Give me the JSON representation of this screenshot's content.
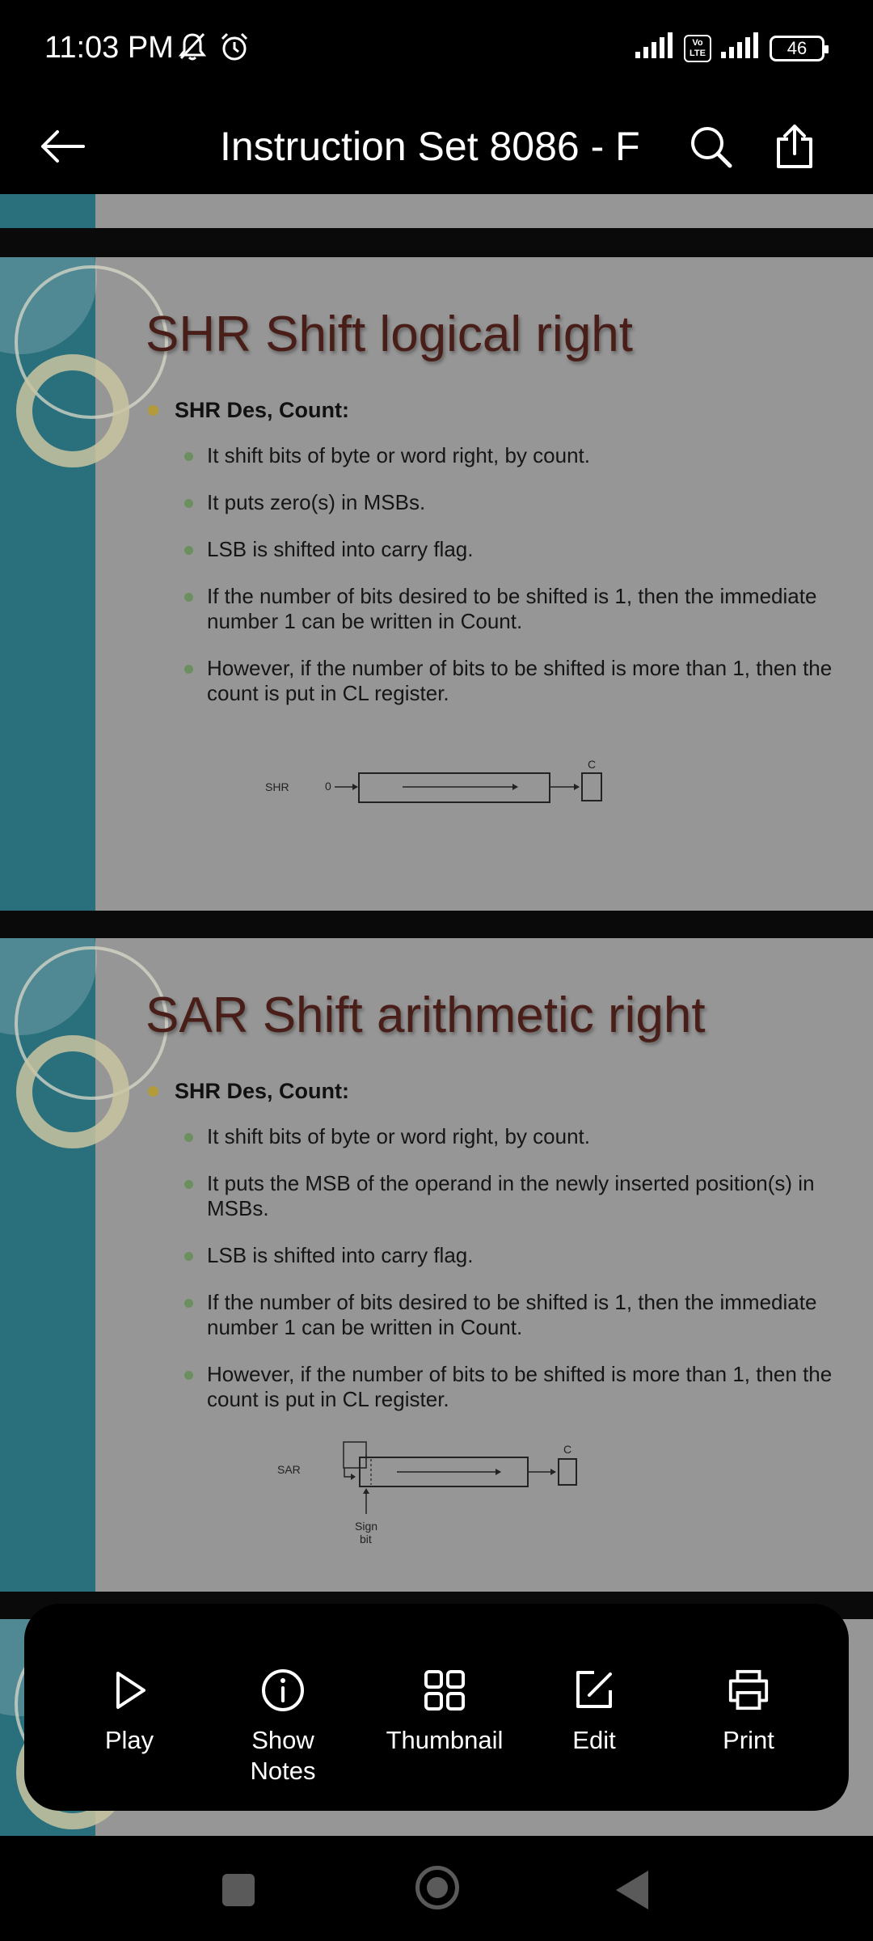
{
  "status_bar": {
    "time": "11:03 PM",
    "battery": "46",
    "volte_label": "Vo LTE",
    "icons": [
      "mute-bell-icon",
      "alarm-icon",
      "signal-icon",
      "volte-icon",
      "signal-icon",
      "battery-icon"
    ]
  },
  "app_bar": {
    "title": "Instruction Set 8086 - F",
    "icons": [
      "back-arrow-icon",
      "search-icon",
      "share-icon"
    ]
  },
  "slides": [
    {
      "title": "SHR Shift logical right",
      "main_bullet": "SHR Des, Count:",
      "sub_bullets": [
        "It shift bits of byte or word right, by count.",
        "It puts zero(s) in MSBs.",
        "LSB is shifted into carry flag.",
        "If the number of bits desired to be shifted is 1, then the  immediate number 1 can be written in Count.",
        "However, if the number of bits to be shifted is more than  1, then the count is put in CL register."
      ],
      "diagram": {
        "label": "SHR",
        "input": "0",
        "carry": "C"
      }
    },
    {
      "title": "SAR Shift arithmetic right",
      "main_bullet": "SHR Des, Count:",
      "sub_bullets": [
        "It shift bits of byte or word right, by count.",
        "It puts the MSB of the operand in the newly inserted position(s) in MSBs.",
        "LSB is shifted into carry flag.",
        "If the number of bits desired to be shifted is 1, then the  immediate number 1 can be written in Count.",
        "However, if the number of bits to be shifted is more than  1, then the count is put in CL register."
      ],
      "diagram": {
        "label": "SAR",
        "carry": "C",
        "sign_label_1": "Sign",
        "sign_label_2": "bit"
      }
    }
  ],
  "bottom_menu": {
    "items": [
      {
        "label": "Play",
        "icon": "play-icon"
      },
      {
        "label": "Show Notes",
        "icon": "info-icon"
      },
      {
        "label": "Thumbnail",
        "icon": "grid-icon"
      },
      {
        "label": "Edit",
        "icon": "edit-icon"
      },
      {
        "label": "Print",
        "icon": "printer-icon"
      }
    ]
  },
  "nav_bar": {
    "icons": [
      "recents-square-icon",
      "home-circle-icon",
      "back-triangle-icon"
    ]
  }
}
